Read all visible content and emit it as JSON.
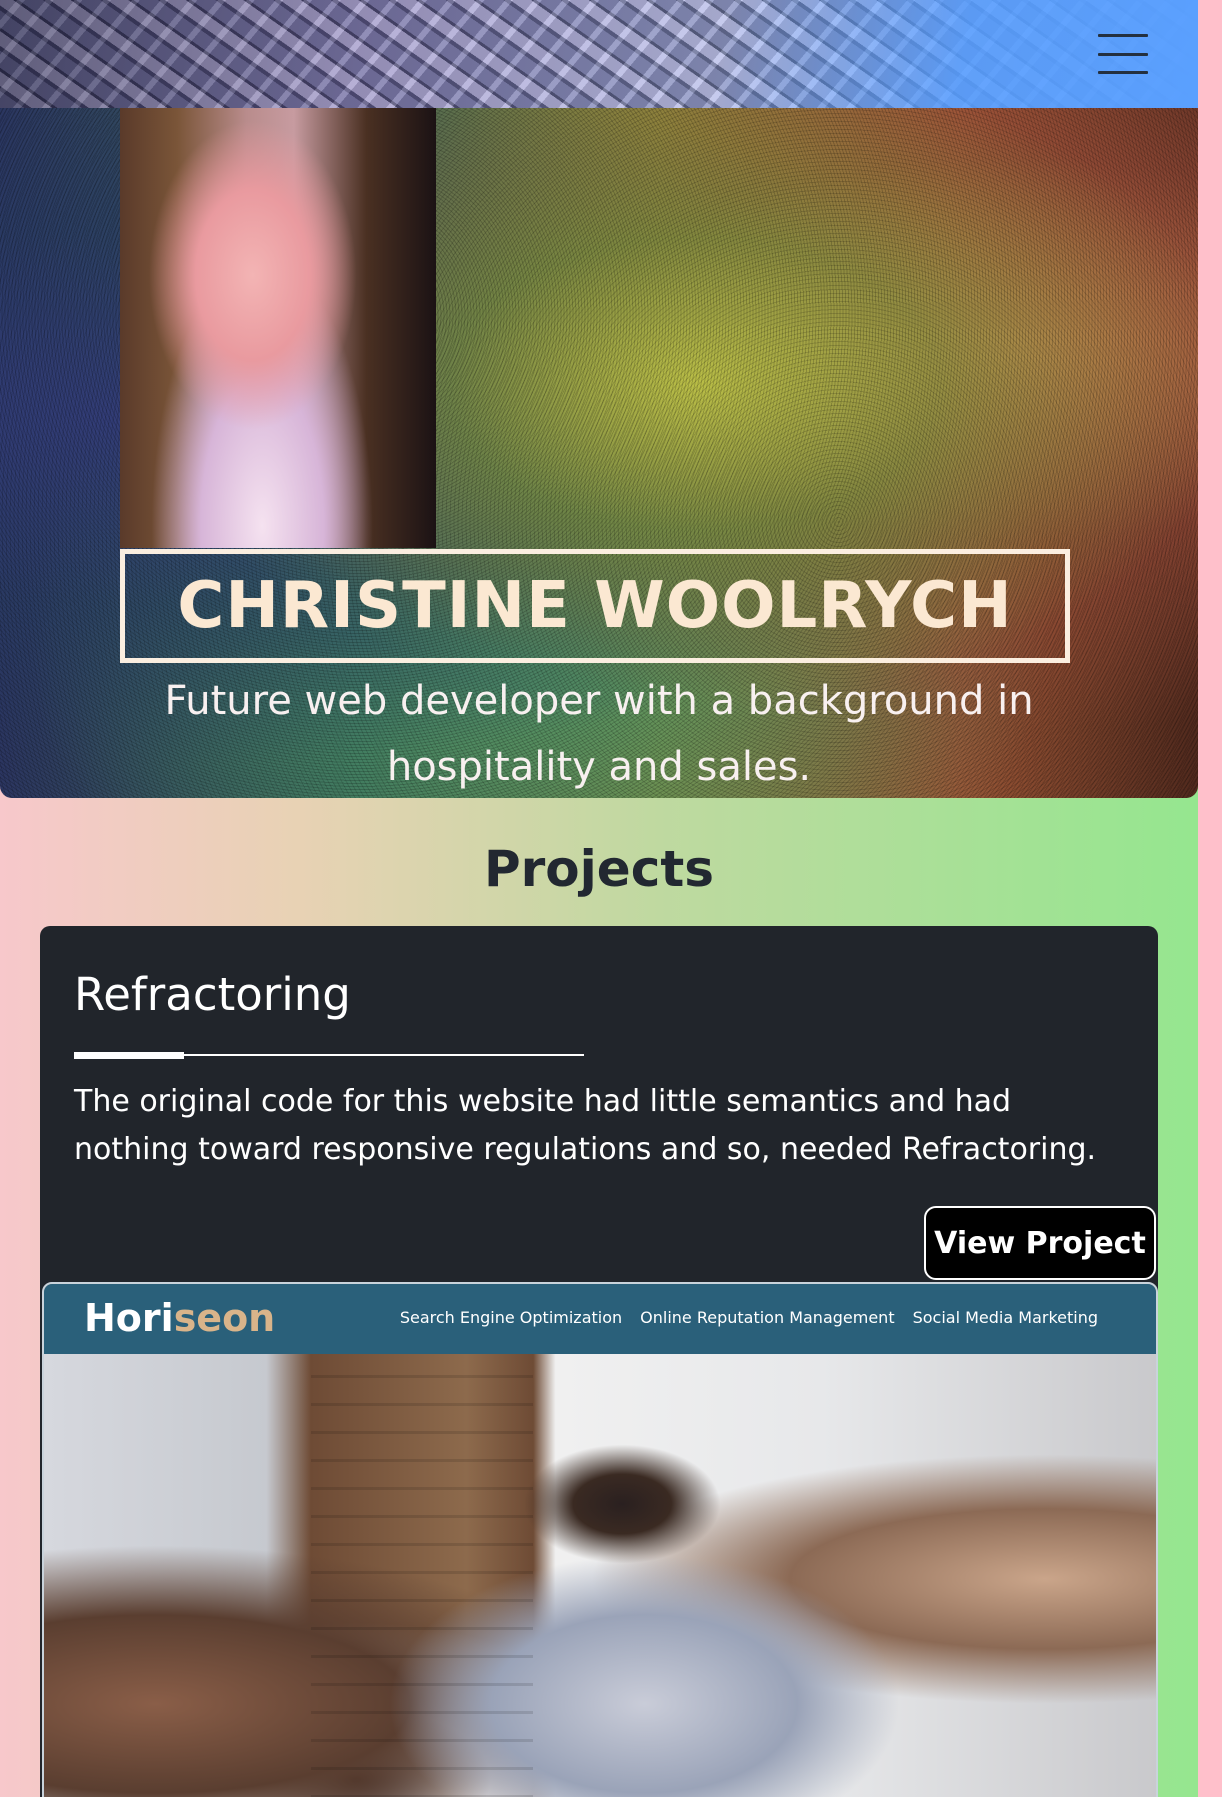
{
  "header": {
    "menu_icon": "hamburger-menu-icon"
  },
  "hero": {
    "name": "CHRISTINE WOOLRYCH",
    "tagline": "Future web developer with a background in hospitality and sales."
  },
  "projects": {
    "heading": "Projects",
    "items": [
      {
        "title": "Refractoring",
        "description": "The original code for this website had little semantics and had nothing toward responsive regulations and so, needed Refractoring.",
        "button_label": "View Project",
        "preview": {
          "logo_main": "Hori",
          "logo_accent": "seon",
          "nav": [
            "Search Engine Optimization",
            "Online Reputation Management",
            "Social Media Marketing"
          ]
        }
      }
    ]
  },
  "colors": {
    "card_bg": "#21252b",
    "page_right": "#95e68f",
    "page_left": "#f7c8cb",
    "name_color": "#fbe8d2",
    "preview_bar": "#2a607a"
  }
}
